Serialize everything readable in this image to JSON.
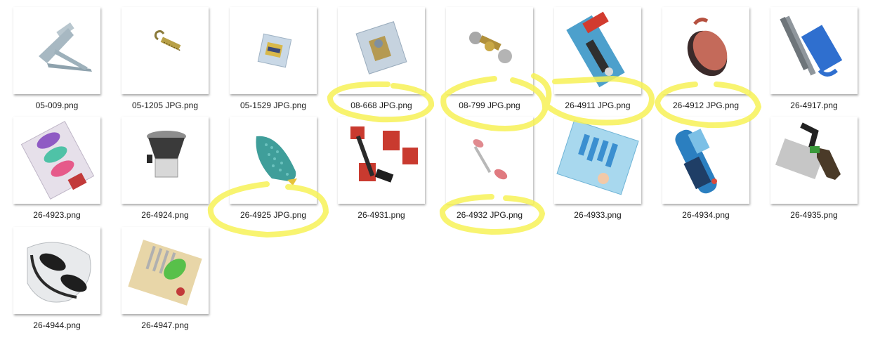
{
  "files": [
    {
      "name": "05-009.png",
      "icon": "stand-bracket-icon",
      "highlighted": false
    },
    {
      "name": "05-1205 JPG.png",
      "icon": "screw-hook-icon",
      "highlighted": false
    },
    {
      "name": "05-1529 JPG.png",
      "icon": "packaged-part-icon",
      "highlighted": false
    },
    {
      "name": "08-668 JPG.png",
      "icon": "blister-pack-icon",
      "highlighted": true
    },
    {
      "name": "08-799 JPG.png",
      "icon": "door-knob-icon",
      "highlighted": true
    },
    {
      "name": "26-4911 JPG.png",
      "icon": "carded-tool-icon",
      "highlighted": true
    },
    {
      "name": "26-4912 JPG.png",
      "icon": "brush-icon",
      "highlighted": true
    },
    {
      "name": "26-4917.png",
      "icon": "mop-tool-icon",
      "highlighted": false
    },
    {
      "name": "26-4923.png",
      "icon": "container-set-icon",
      "highlighted": false
    },
    {
      "name": "26-4924.png",
      "icon": "chopper-icon",
      "highlighted": false
    },
    {
      "name": "26-4925 JPG.png",
      "icon": "iron-shoe-icon",
      "highlighted": true
    },
    {
      "name": "26-4931.png",
      "icon": "furniture-mover-icon",
      "highlighted": false
    },
    {
      "name": "26-4932 JPG.png",
      "icon": "face-roller-icon",
      "highlighted": true
    },
    {
      "name": "26-4933.png",
      "icon": "grooming-kit-icon",
      "highlighted": false
    },
    {
      "name": "26-4934.png",
      "icon": "portable-blender-icon",
      "highlighted": false
    },
    {
      "name": "26-4935.png",
      "icon": "garden-sprayer-icon",
      "highlighted": false
    },
    {
      "name": "26-4944.png",
      "icon": "goggles-icon",
      "highlighted": false
    },
    {
      "name": "26-4947.png",
      "icon": "food-holder-icon",
      "highlighted": false
    }
  ],
  "highlight_color": "#f7f257"
}
